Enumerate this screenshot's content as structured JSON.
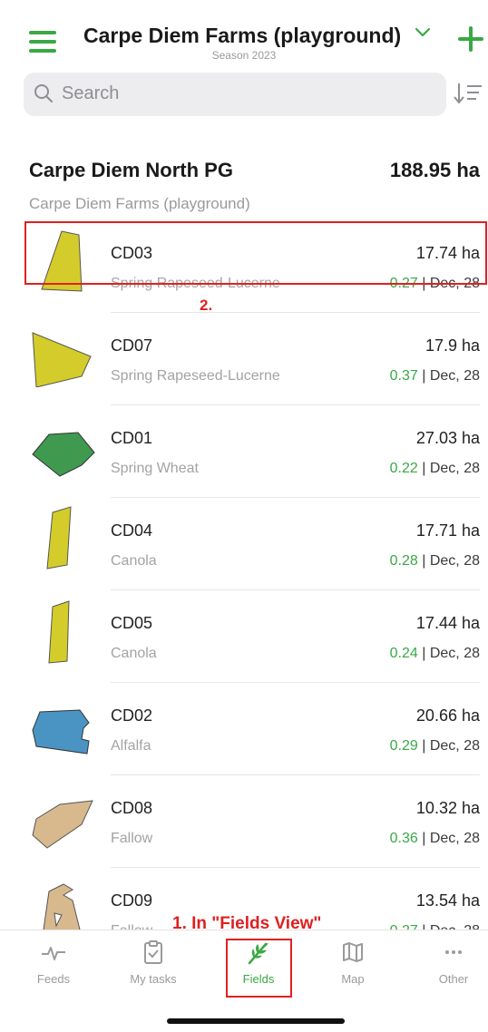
{
  "header": {
    "title": "Carpe Diem Farms (playground)",
    "season": "Season 2023"
  },
  "search": {
    "placeholder": "Search"
  },
  "farm": {
    "name": "Carpe Diem North PG",
    "area": "188.95 ha",
    "org": "Carpe Diem Farms (playground)"
  },
  "fields": [
    {
      "name": "CD03",
      "crop": "Spring Rapeseed-Lucerne",
      "area": "17.74 ha",
      "ndvi": "0.27",
      "date": "| Dec, 28",
      "color": "#d4cc2a"
    },
    {
      "name": "CD07",
      "crop": "Spring Rapeseed-Lucerne",
      "area": "17.9 ha",
      "ndvi": "0.37",
      "date": "| Dec, 28",
      "color": "#d4cc2a"
    },
    {
      "name": "CD01",
      "crop": "Spring Wheat",
      "area": "27.03 ha",
      "ndvi": "0.22",
      "date": "| Dec, 28",
      "color": "#3f9a4f"
    },
    {
      "name": "CD04",
      "crop": "Canola",
      "area": "17.71 ha",
      "ndvi": "0.28",
      "date": "| Dec, 28",
      "color": "#d4cc2a"
    },
    {
      "name": "CD05",
      "crop": "Canola",
      "area": "17.44 ha",
      "ndvi": "0.24",
      "date": "| Dec, 28",
      "color": "#d4cc2a"
    },
    {
      "name": "CD02",
      "crop": "Alfalfa",
      "area": "20.66 ha",
      "ndvi": "0.29",
      "date": "| Dec, 28",
      "color": "#4a94c4"
    },
    {
      "name": "CD08",
      "crop": "Fallow",
      "area": "10.32 ha",
      "ndvi": "0.36",
      "date": "| Dec, 28",
      "color": "#d8b98e"
    },
    {
      "name": "CD09",
      "crop": "Fallow",
      "area": "13.54 ha",
      "ndvi": "0.27",
      "date": "| Dec, 28",
      "color": "#d8b98e"
    }
  ],
  "annotations": {
    "step1": "1. In \"Fields View\"",
    "step2": "2."
  },
  "tabs": [
    {
      "label": "Feeds",
      "icon": "pulse-icon"
    },
    {
      "label": "My tasks",
      "icon": "clipboard-check-icon"
    },
    {
      "label": "Fields",
      "icon": "leaf-icon",
      "active": true
    },
    {
      "label": "Map",
      "icon": "map-icon"
    },
    {
      "label": "Other",
      "icon": "more-dots-icon"
    }
  ],
  "colors": {
    "accent": "#3aa845",
    "annotation": "#e02020"
  }
}
